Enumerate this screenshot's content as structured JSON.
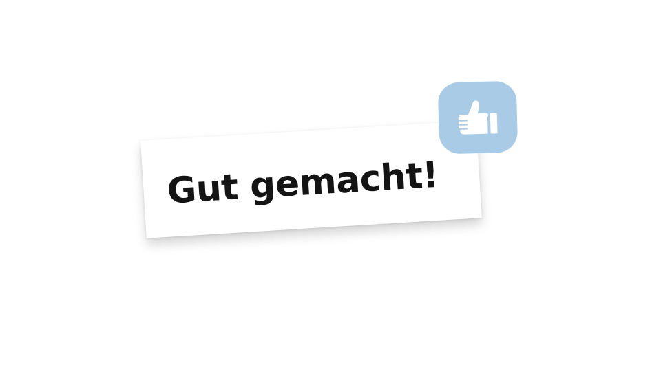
{
  "message": {
    "text": "Gut gemacht!"
  },
  "icon": {
    "name": "thumbs-up-icon",
    "bubble_color": "#a9cbe6",
    "glyph_color": "#ffffff"
  }
}
